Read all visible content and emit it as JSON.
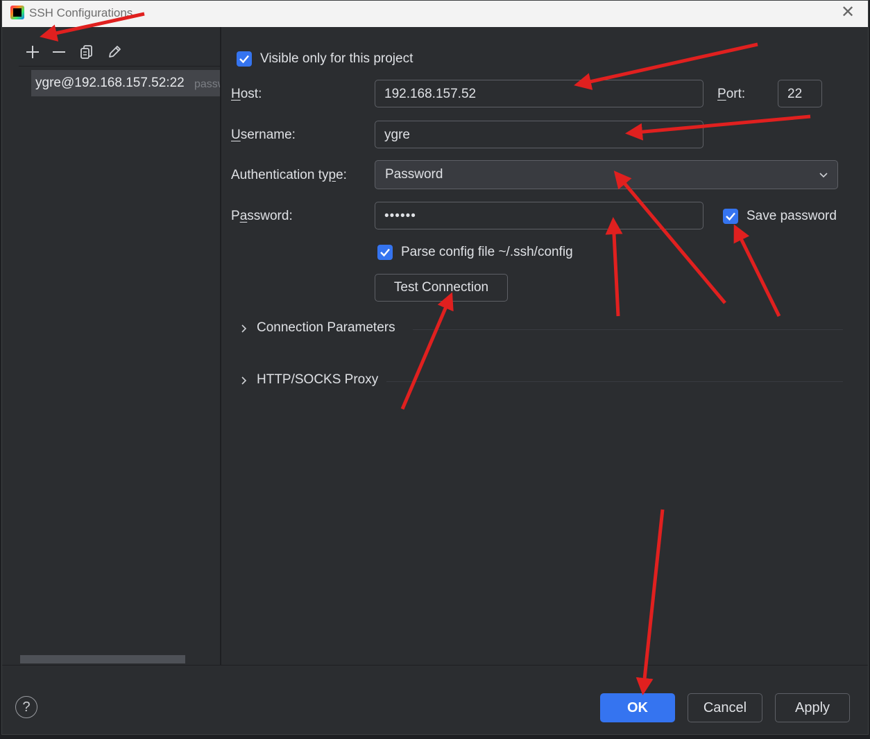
{
  "window": {
    "title": "SSH Configurations",
    "close_icon": "close-icon",
    "app_icon": "jetbrains-app-icon"
  },
  "sidebar": {
    "toolbar": {
      "add_icon": "plus-icon",
      "remove_icon": "minus-icon",
      "copy_icon": "copy-icon",
      "edit_icon": "pencil-icon"
    },
    "items": [
      {
        "host": "ygre@192.168.157.52:22",
        "auth_hint": "passw"
      }
    ]
  },
  "form": {
    "visible_only": {
      "label": "Visible only for this project",
      "checked": true
    },
    "host": {
      "label_prefix": "",
      "label_mnemonic": "H",
      "label_rest": "ost:",
      "value": "192.168.157.52"
    },
    "port": {
      "label_mnemonic": "P",
      "label_rest": "ort:",
      "value": "22"
    },
    "username": {
      "label_mnemonic": "U",
      "label_rest": "sername:",
      "value": "ygre"
    },
    "auth_type": {
      "label_prefix": "Authentication ty",
      "label_mnemonic": "p",
      "label_rest": "e:",
      "value": "Password",
      "chevron_icon": "chevron-down-icon"
    },
    "password": {
      "label_prefix": "P",
      "label_mnemonic": "a",
      "label_rest": "ssword:",
      "value": "••••••"
    },
    "save_password": {
      "label": "Save password",
      "checked": true
    },
    "parse_config": {
      "label": "Parse config file ~/.ssh/config",
      "checked": true
    },
    "test_connection": "Test Connection"
  },
  "sections": [
    {
      "label": "Connection Parameters",
      "expanded": false
    },
    {
      "label": "HTTP/SOCKS Proxy",
      "expanded": false
    }
  ],
  "footer": {
    "help": "?",
    "ok": "OK",
    "cancel": "Cancel",
    "apply": "Apply"
  },
  "colors": {
    "accent": "#3574f0",
    "background": "#2b2d30",
    "annotation_arrow": "#e0201f"
  }
}
